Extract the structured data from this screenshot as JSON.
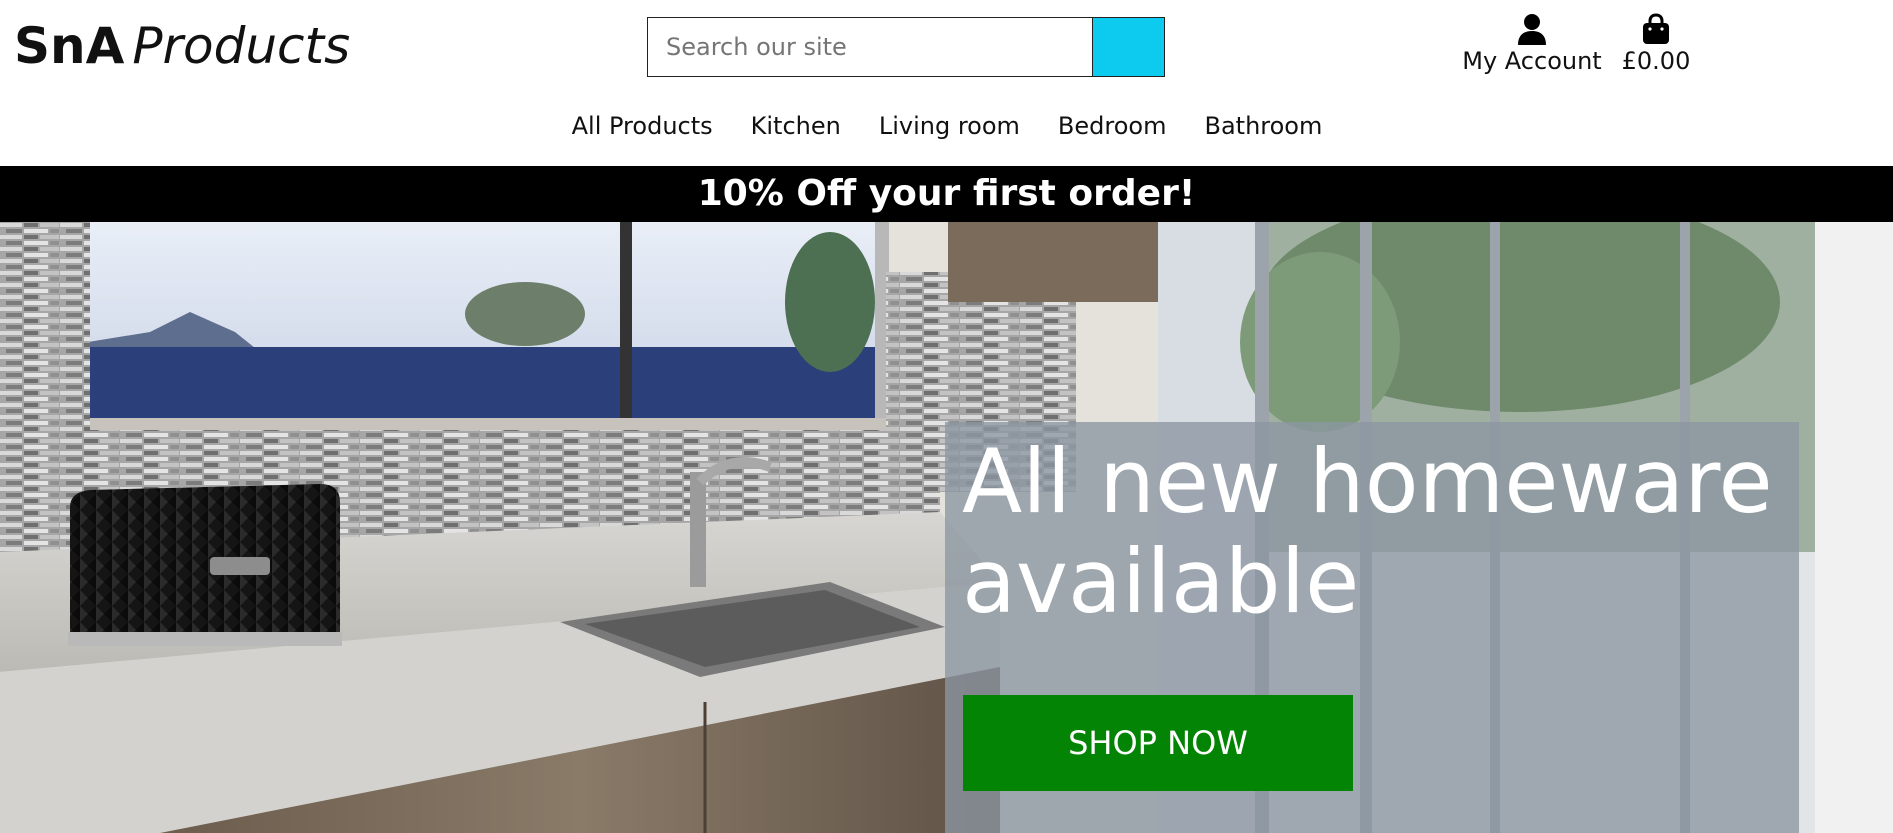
{
  "brand": {
    "bold_part": "SnA",
    "italic_part": "Products"
  },
  "search": {
    "placeholder": "Search our site",
    "button_color": "#0ccbef",
    "button_icon": "search-icon"
  },
  "account": {
    "label": "My Account",
    "icon": "user-icon"
  },
  "bag": {
    "label": "£0.00",
    "icon": "shopping-bag-icon"
  },
  "nav": {
    "items": [
      {
        "label": "All Products"
      },
      {
        "label": "Kitchen"
      },
      {
        "label": "Living room"
      },
      {
        "label": "Bedroom"
      },
      {
        "label": "Bathroom"
      }
    ]
  },
  "banner": {
    "text": "10% Off your first order!",
    "background": "#000000"
  },
  "hero": {
    "title": "All new homeware available",
    "cta_label": "SHOP NOW",
    "cta_color": "#048404",
    "image": "kitchen-interior-photo"
  }
}
